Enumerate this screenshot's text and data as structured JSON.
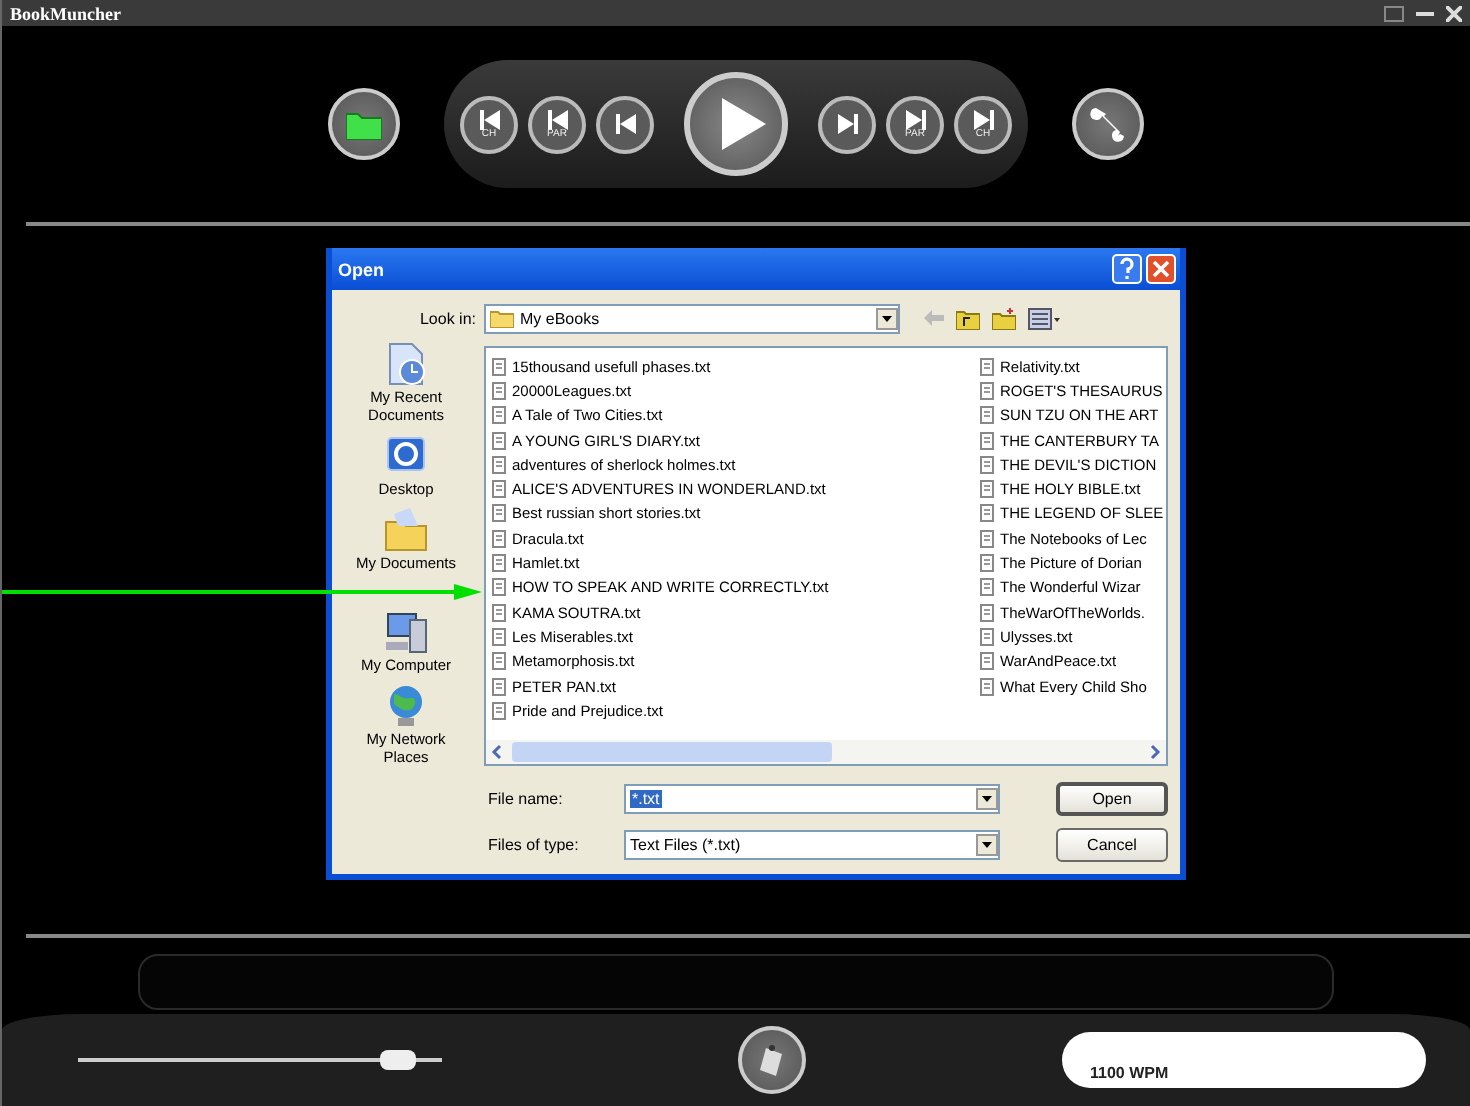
{
  "window": {
    "title": "BookMuncher"
  },
  "transport": [
    {
      "kind": "skip-back",
      "label": "CH"
    },
    {
      "kind": "skip-back",
      "label": "PAR"
    },
    {
      "kind": "step-back"
    },
    {
      "kind": "play"
    },
    {
      "kind": "step-forward"
    },
    {
      "kind": "skip-forward",
      "label": "PAR"
    },
    {
      "kind": "skip-forward",
      "label": "CH"
    }
  ],
  "dialog": {
    "title": "Open",
    "look_in_label": "Look in:",
    "look_in_value": "My eBooks",
    "places": [
      "My Recent Documents",
      "Desktop",
      "My Documents",
      "My Computer",
      "My Network Places"
    ],
    "files_column_1": [
      "15thousand usefull phases.txt",
      "20000Leagues.txt",
      "A Tale of Two Cities.txt",
      "A YOUNG GIRL'S DIARY.txt",
      "adventures of sherlock holmes.txt",
      "ALICE'S ADVENTURES IN WONDERLAND.txt",
      "Best russian short stories.txt",
      "Dracula.txt",
      "Hamlet.txt",
      "HOW TO SPEAK AND WRITE CORRECTLY.txt",
      "KAMA SOUTRA.txt",
      "Les Miserables.txt",
      "Metamorphosis.txt",
      "PETER PAN.txt",
      "Pride and Prejudice.txt"
    ],
    "files_column_2": [
      "Relativity.txt",
      "ROGET'S THESAURUS",
      "SUN TZU ON THE ART",
      "THE CANTERBURY TA",
      "THE DEVIL'S DICTION",
      "THE HOLY BIBLE.txt",
      "THE LEGEND OF SLEE",
      "The Notebooks of Lec",
      "The Picture of Dorian",
      "The Wonderful Wizar",
      "TheWarOfTheWorlds.",
      "Ulysses.txt",
      "WarAndPeace.txt",
      "What Every Child Sho"
    ],
    "file_name_label": "File name:",
    "file_name_value": "*.txt",
    "file_type_label": "Files of type:",
    "file_type_value": "Text Files (*.txt)",
    "buttons": [
      "Open",
      "Cancel"
    ]
  },
  "speed_slider": {
    "level": 0.93
  },
  "wpm": "1100 WPM"
}
